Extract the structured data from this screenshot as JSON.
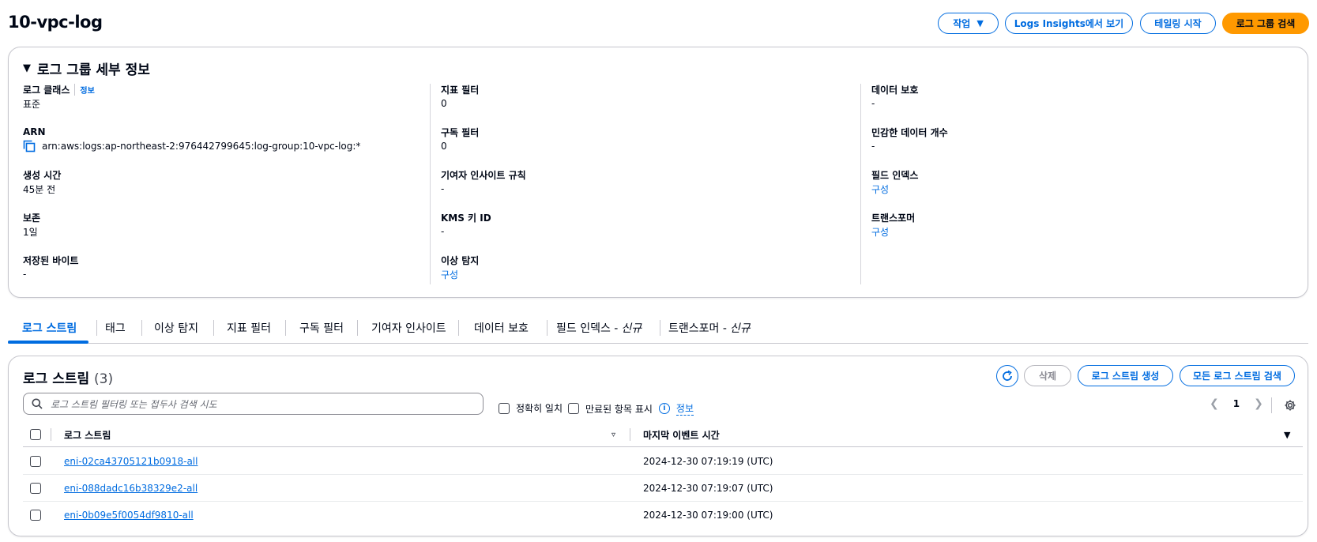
{
  "header": {
    "title": "10-vpc-log",
    "actions_label": "작업",
    "logs_insights_label": "Logs Insights에서 보기",
    "tailing_label": "테일링 시작",
    "search_group_label": "로그 그룹 검색"
  },
  "details": {
    "title": "로그 그룹 세부 정보",
    "info_label": "정보",
    "col1": [
      {
        "label": "로그 클래스",
        "value": "표준"
      },
      {
        "label": "ARN",
        "value": "arn:aws:logs:ap-northeast-2:976442799645:log-group:10-vpc-log:*"
      },
      {
        "label": "생성 시간",
        "value": "45분 전"
      },
      {
        "label": "보존",
        "value": "1일"
      },
      {
        "label": "저장된 바이트",
        "value": "-"
      }
    ],
    "col2": [
      {
        "label": "지표 필터",
        "value": "0"
      },
      {
        "label": "구독 필터",
        "value": "0"
      },
      {
        "label": "기여자 인사이트 규칙",
        "value": "-"
      },
      {
        "label": "KMS 키 ID",
        "value": "-"
      },
      {
        "label": "이상 탐지",
        "value": "구성"
      }
    ],
    "col3": [
      {
        "label": "데이터 보호",
        "value": "-"
      },
      {
        "label": "민감한 데이터 개수",
        "value": "-"
      },
      {
        "label": "필드 인덱스",
        "value": "구성"
      },
      {
        "label": "트랜스포머",
        "value": "구성"
      }
    ]
  },
  "tabs": {
    "log_streams": "로그 스트림",
    "tags": "태그",
    "anomaly": "이상 탐지",
    "metric_filters": "지표 필터",
    "subscription_filters": "구독 필터",
    "contributor_insights": "기여자 인사이트",
    "data_protection": "데이터 보호",
    "field_index": "필드 인덱스 -",
    "transformer": "트랜스포머 -",
    "new_badge": "신규"
  },
  "streams": {
    "title": "로그 스트림",
    "count": "(3)",
    "delete_label": "삭제",
    "create_label": "로그 스트림 생성",
    "search_all_label": "모든 로그 스트림 검색",
    "search_placeholder": "로그 스트림 필터링 또는 접두사 검색 시도",
    "exact_match": "정확히 일치",
    "show_expired": "만료된 항목 표시",
    "info": "정보",
    "page": "1",
    "col_stream": "로그 스트림",
    "col_last_event": "마지막 이벤트 시간",
    "rows": [
      {
        "name": "eni-02ca43705121b0918-all",
        "time": "2024-12-30 07:19:19 (UTC)"
      },
      {
        "name": "eni-088dadc16b38329e2-all",
        "time": "2024-12-30 07:19:07 (UTC)"
      },
      {
        "name": "eni-0b09e5f0054df9810-all",
        "time": "2024-12-30 07:19:00 (UTC)"
      }
    ]
  }
}
